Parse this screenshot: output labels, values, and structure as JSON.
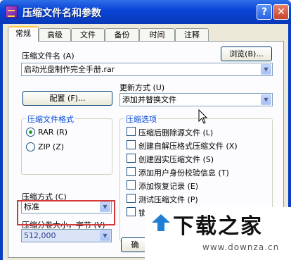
{
  "window": {
    "title": "压缩文件名和参数",
    "help_label": "?",
    "close_label": "✕",
    "icon": "winrar-icon"
  },
  "tabs": [
    {
      "label": "常规",
      "active": true
    },
    {
      "label": "高级",
      "active": false
    },
    {
      "label": "文件",
      "active": false
    },
    {
      "label": "备份",
      "active": false
    },
    {
      "label": "时间",
      "active": false
    },
    {
      "label": "注释",
      "active": false
    }
  ],
  "archive_name": {
    "label": "压缩文件名 (A)",
    "value": "启动光盘制作完全手册.rar",
    "browse_label": "浏览(B)..."
  },
  "update_mode": {
    "label": "更新方式 (U)",
    "value": "添加并替换文件"
  },
  "profiles_button": "配置 (F)...",
  "format_group": {
    "title": "压缩文件格式",
    "options": [
      {
        "label": "RAR (R)",
        "selected": true
      },
      {
        "label": "ZIP (Z)",
        "selected": false
      }
    ]
  },
  "compression_method": {
    "label": "压缩方式 (C)",
    "value": "标准"
  },
  "volume_size": {
    "label": "压缩分卷大小，字节 (V)",
    "value": "512,000"
  },
  "options_group": {
    "title": "压缩选项",
    "items": [
      {
        "label": "压缩后删除源文件 (L)",
        "checked": false
      },
      {
        "label": "创建自解压格式压缩文件 (X)",
        "checked": false
      },
      {
        "label": "创建固实压缩文件 (S)",
        "checked": false
      },
      {
        "label": "添加用户身份校验信息 (T)",
        "checked": false
      },
      {
        "label": "添加恢复记录 (E)",
        "checked": false
      },
      {
        "label": "测试压缩文件 (P)",
        "checked": false
      },
      {
        "label": "锁",
        "checked": false
      }
    ]
  },
  "ok_button": "确",
  "watermark": {
    "brand": "下载之家",
    "url": "www.downza.cn"
  },
  "colors": {
    "titlebar": "#0a45d8",
    "group_title": "#0046d5",
    "highlight_box": "#d23a3a",
    "dialog_bg": "#ece9d8"
  }
}
